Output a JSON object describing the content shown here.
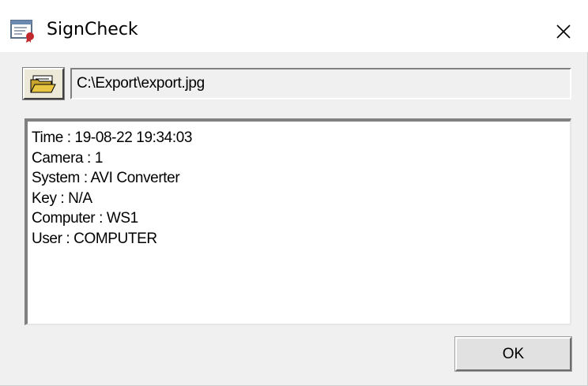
{
  "window": {
    "title": "SignCheck",
    "app_icon": "certificate-icon",
    "close_icon": "close-icon"
  },
  "file": {
    "open_icon": "open-folder-icon",
    "path": "C:\\Export\\export.jpg"
  },
  "info": {
    "lines": [
      "Time : 19-08-22 19:34:03",
      "Camera : 1",
      "System : AVI Converter",
      "Key : N/A",
      "Computer : WS1",
      "User : COMPUTER"
    ]
  },
  "buttons": {
    "ok_label": "OK"
  },
  "colors": {
    "window_bg": "#f0f0f0",
    "titlebar_bg": "#ffffff",
    "info_bg": "#ffffff",
    "folder_yellow": "#e8c642"
  }
}
